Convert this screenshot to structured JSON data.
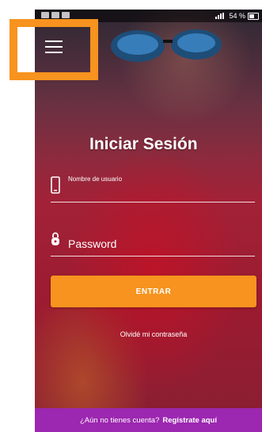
{
  "status_bar": {
    "battery_text": "54 %"
  },
  "header": {
    "menu_icon": "hamburger-menu-icon"
  },
  "login": {
    "title": "Iniciar Sesión",
    "username_placeholder": "Nombre de usuario",
    "username_icon": "phone-icon",
    "password_placeholder": "Password",
    "password_icon": "lock-icon",
    "submit_label": "ENTRAR",
    "forgot_label": "Olvidé mi contraseña"
  },
  "footer": {
    "prompt": "¿Aún no tienes cuenta?",
    "register_label": "Regístrate aquí"
  },
  "colors": {
    "accent": "#f7931e",
    "footer_bg": "#9c27b0"
  }
}
